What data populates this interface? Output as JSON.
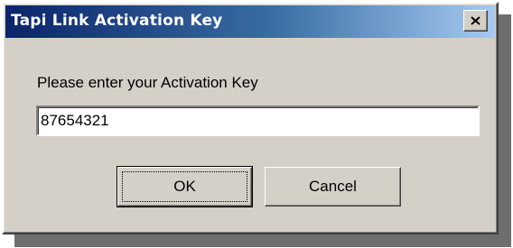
{
  "window": {
    "title": "Tapi Link Activation Key",
    "close_icon": "close-icon"
  },
  "form": {
    "prompt": "Please enter your Activation Key",
    "activation_key_value": "87654321"
  },
  "buttons": {
    "ok_label": "OK",
    "cancel_label": "Cancel"
  },
  "colors": {
    "title_gradient_start": "#0a246a",
    "title_gradient_end": "#a6caf0",
    "dialog_face": "#d4d0c8"
  }
}
